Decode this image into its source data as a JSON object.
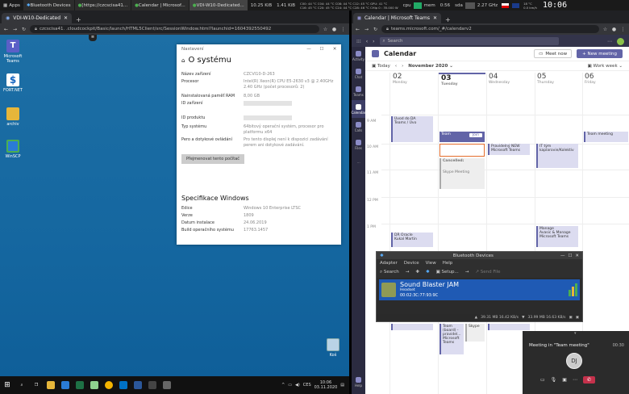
{
  "topbar": {
    "apps": "Apps",
    "tasks": [
      "Bluetooth Devices",
      "[https://czcscisa41...",
      "Calendar | Microsof...",
      "VDI-W10-Dedicated..."
    ],
    "net_down": "10.25 KiB",
    "net_up": "1.41 KiB",
    "cpu_info_1": "C00: 44 °C  C04: 44 °C  C08: 44 °C  C12: 45 °C  GPU: 41 °C",
    "cpu_info_2": "C16: 45 °C  C20: 45 °C  C24: 44 °C  C28: 46 °C  CHip 0 : 35.000 W",
    "cpu_label": "cpu",
    "mem_label": "mem",
    "mem_val": "0:56",
    "disk_label": "sda",
    "freq": "2.27 GHz",
    "weather_1": "18 °C",
    "weather_2": "0.0 km/h",
    "clock": "10:06"
  },
  "left_browser": {
    "tab_title": "VDI-W10-Dedicated",
    "url": "czcscisa41.      .cloudcockpit/Basic/launch/HTML5Client/src/SessionWindow.html?launchid=1604392550492"
  },
  "desktop_icons": [
    {
      "label": "Microsoft Teams",
      "color": "#5b5fc7"
    },
    {
      "label": "FORT.NET",
      "color": "#1565c0"
    },
    {
      "label": "archiv",
      "color": "#e6b63a"
    },
    {
      "label": "WinSCP",
      "color": "#2a7bd6"
    }
  ],
  "recycle_bin": "Koš",
  "settings": {
    "title": "Nastavení",
    "heading": "O systému",
    "rows": [
      {
        "k": "Název zařízení",
        "v": "CZCVI10-D-263"
      },
      {
        "k": "Procesor",
        "v": "Intel(R) Xeon(R) CPU E5-2630 v3 @ 2.40GHz   2.40 GHz (počet procesorů: 2)"
      },
      {
        "k": "Nainstalovaná paměť RAM",
        "v": "8,00 GB"
      },
      {
        "k": "ID zařízení",
        "v": ""
      },
      {
        "k": "ID produktu",
        "v": ""
      },
      {
        "k": "Typ systému",
        "v": "64bitový operační systém, procesor pro platformu x64"
      },
      {
        "k": "Pero a dotykové ovládání",
        "v": "Pro tento displej není k dispozici zadávání perem ani dotykové zadávání."
      }
    ],
    "rename_button": "Přejmenovat tento počítač",
    "spec_heading": "Specifikace Windows",
    "spec_rows": [
      {
        "k": "Edice",
        "v": "Windows 10 Enterprise LTSC"
      },
      {
        "k": "Verze",
        "v": "1809"
      },
      {
        "k": "Datum instalace",
        "v": "24.06.2019"
      },
      {
        "k": "Build operačního systému",
        "v": "17763.1457"
      }
    ]
  },
  "win_taskbar": {
    "time": "10:06",
    "date": "03.11.2020",
    "lang": "CES"
  },
  "right_browser": {
    "tab_title": "Calendar | Microsoft Teams",
    "url": "teams.microsoft.com/_#/calendarv2"
  },
  "teams": {
    "search_placeholder": "Search",
    "rail": [
      "Activity",
      "Chat",
      "Teams",
      "Calendar",
      "Calls",
      "Files",
      "",
      "Help"
    ],
    "calendar_title": "Calendar",
    "meet_now": "Meet now",
    "new_meeting": "+ New meeting",
    "today": "Today",
    "month": "November 2020",
    "view": "Work week",
    "days": [
      {
        "num": "02",
        "name": "Monday"
      },
      {
        "num": "03",
        "name": "Tuesday"
      },
      {
        "num": "04",
        "name": "Wednesday"
      },
      {
        "num": "05",
        "name": "Thursday"
      },
      {
        "num": "06",
        "name": "Friday"
      }
    ],
    "times": [
      "9 AM",
      "10 AM",
      "11 AM",
      "12 PM",
      "1 PM"
    ],
    "events": {
      "e1_title": "Úvod do DA",
      "e1_sub": "Teams / Úvo",
      "e2_title": "Team",
      "e2_join": "Join",
      "e3_title": "Pravidelný NEW",
      "e3_sub": "Microsoft Teams",
      "e4_title": "IT tým",
      "e4_sub": "kaplarovie/Kolektiv",
      "e5_title": "Team meeting",
      "e6_title": "Cancelled:",
      "e6_sub": "Skype Meeting",
      "e7_title": "DR Oracle",
      "e7_sub": "Kukal Martin",
      "e8_title": "Manage",
      "e8_sub": "Avasic & Manage",
      "e8_sub2": "Microsoft Teams",
      "e9_title": "Team (board) - pravidel...",
      "e9_sub": "Microsoft Teams",
      "e10_title": "Skype"
    }
  },
  "bluetooth": {
    "title": "Bluetooth Devices",
    "menu": [
      "Adapter",
      "Device",
      "View",
      "Help"
    ],
    "search": "Search",
    "setup": "Setup...",
    "send_file": "Send File",
    "device_name": "Sound Blaster JAM",
    "device_type": "Headset",
    "device_addr": "00:02:3C:77:93:9C",
    "status_1": "39.31 MB 16.42 KB/s",
    "status_2": "33.99 MB 16.63 KB/s"
  },
  "meeting_popup": {
    "title": "Meeting in \"Team meeting\"",
    "time": "00:30",
    "avatar": "DJ"
  }
}
